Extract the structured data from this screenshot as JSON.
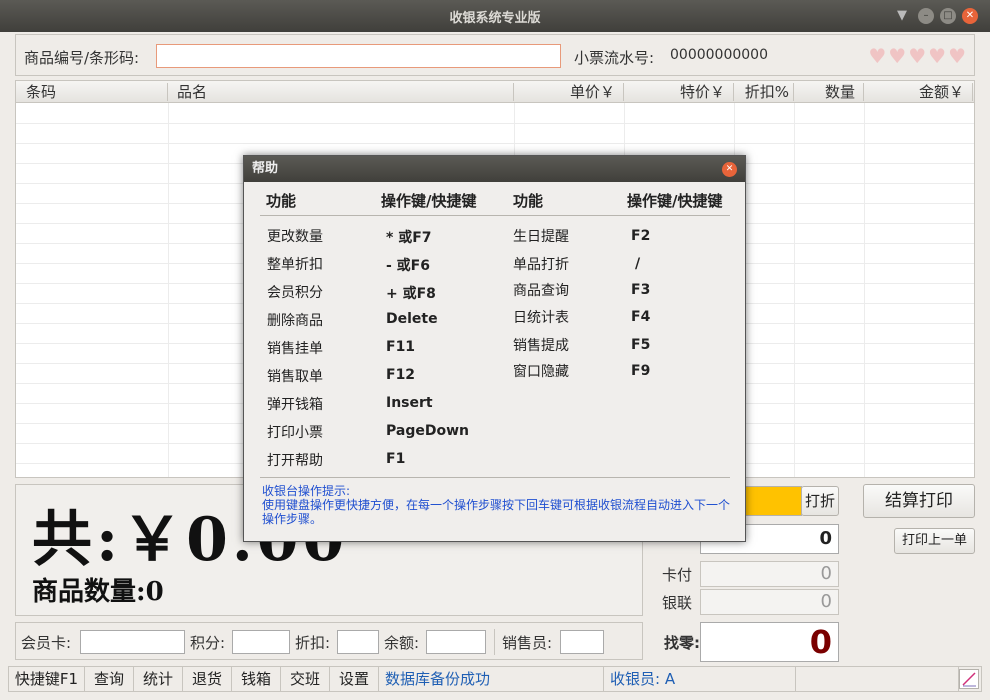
{
  "window": {
    "title": "收银系统专业版"
  },
  "top": {
    "code_label": "商品编号/条形码:",
    "code_value": "",
    "receipt_label": "小票流水号:",
    "receipt_value": "00000000000",
    "hearts": "♥♥♥♥♥"
  },
  "table": {
    "columns": [
      "条码",
      "品名",
      "单价￥",
      "特价￥",
      "折扣%",
      "数量",
      "金额￥"
    ]
  },
  "total": {
    "big_label": "共:￥0.00",
    "qty_label": "商品数量:",
    "qty_value": "0"
  },
  "member": {
    "card_label": "会员卡:",
    "points_label": "积分:",
    "discount_label": "折扣:",
    "balance_label": "余额:",
    "sales_label": "销售员:"
  },
  "right": {
    "discount_button": "打折",
    "checkout_button": "结算打印",
    "reprint_button": "打印上一单",
    "paid_value": "0",
    "card_label": "卡付",
    "card_value": "0",
    "union_label": "银联",
    "union_value": "0",
    "change_label": "找零:",
    "change_value": "0",
    "accent_yellow": "#ffc200",
    "change_color": "#7a0000"
  },
  "statusbar": {
    "items": [
      "快捷键F1",
      "查询",
      "统计",
      "退货",
      "钱箱",
      "交班",
      "设置"
    ],
    "message": "数据库备份成功",
    "cashier": "收银员: A"
  },
  "help": {
    "title": "帮助",
    "header_fn": "功能",
    "header_key": "操作键/快捷键",
    "left": [
      {
        "fn": "更改数量",
        "key": "* 或F7"
      },
      {
        "fn": "整单折扣",
        "key": "- 或F6"
      },
      {
        "fn": "会员积分",
        "key": "+ 或F8"
      },
      {
        "fn": "删除商品",
        "key": "Delete"
      },
      {
        "fn": "销售挂单",
        "key": "F11"
      },
      {
        "fn": "销售取单",
        "key": "F12"
      },
      {
        "fn": "弹开钱箱",
        "key": "Insert"
      },
      {
        "fn": "打印小票",
        "key": "PageDown"
      },
      {
        "fn": "打开帮助",
        "key": "F1"
      }
    ],
    "right": [
      {
        "fn": "生日提醒",
        "key": "F2"
      },
      {
        "fn": "单品打折",
        "key": "/"
      },
      {
        "fn": "商品查询",
        "key": "F3"
      },
      {
        "fn": "日统计表",
        "key": "F4"
      },
      {
        "fn": "销售提成",
        "key": "F5"
      },
      {
        "fn": "窗口隐藏",
        "key": "F9"
      }
    ],
    "tip_title": "收银台操作提示:",
    "tip_body": "使用键盘操作更快捷方便，在每一个操作步骤按下回车键可根据收银流程自动进入下一个操作步骤。"
  }
}
